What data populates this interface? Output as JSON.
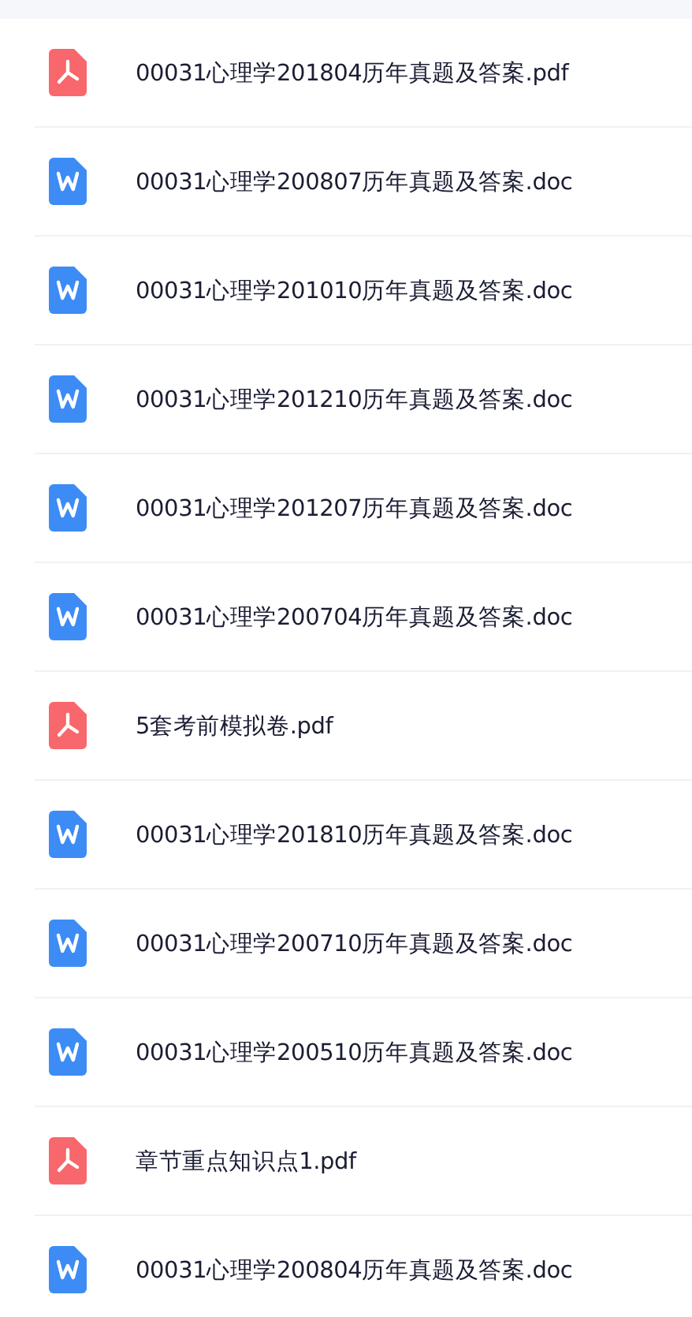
{
  "files": [
    {
      "kind": "pdf",
      "name": "00031心理学201804历年真题及答案.pdf"
    },
    {
      "kind": "doc",
      "name": "00031心理学200807历年真题及答案.doc"
    },
    {
      "kind": "doc",
      "name": "00031心理学201010历年真题及答案.doc"
    },
    {
      "kind": "doc",
      "name": "00031心理学201210历年真题及答案.doc"
    },
    {
      "kind": "doc",
      "name": "00031心理学201207历年真题及答案.doc"
    },
    {
      "kind": "doc",
      "name": "00031心理学200704历年真题及答案.doc"
    },
    {
      "kind": "pdf",
      "name": "5套考前模拟卷.pdf"
    },
    {
      "kind": "doc",
      "name": "00031心理学201810历年真题及答案.doc"
    },
    {
      "kind": "doc",
      "name": "00031心理学200710历年真题及答案.doc"
    },
    {
      "kind": "doc",
      "name": "00031心理学200510历年真题及答案.doc"
    },
    {
      "kind": "pdf",
      "name": "章节重点知识点1.pdf"
    },
    {
      "kind": "doc",
      "name": "00031心理学200804历年真题及答案.doc"
    }
  ]
}
